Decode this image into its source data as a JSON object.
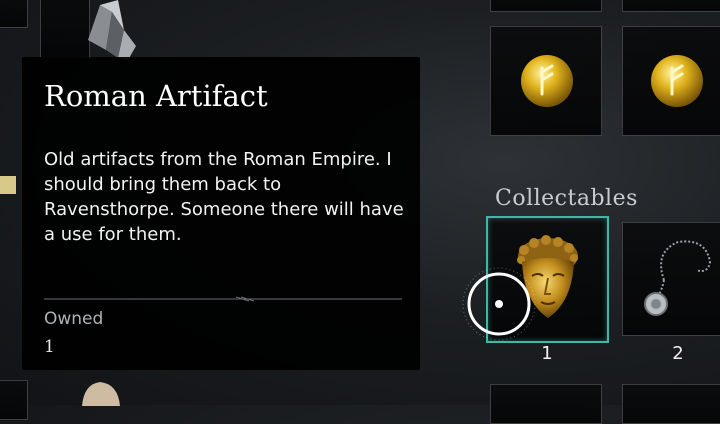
{
  "colors": {
    "accent": "#3fb6a6",
    "panel": "#000000",
    "rune_gold": "#e0b21c"
  },
  "tooltip": {
    "title": "Roman Artifact",
    "description": "Old artifacts from the Roman Empire. I should bring them back to Ravensthorpe. Someone there will have a use for them.",
    "owned_label": "Owned",
    "owned_value": "1"
  },
  "inventory": {
    "section_title": "Collectables",
    "items": [
      {
        "icon": "rune-icon",
        "count": ""
      },
      {
        "icon": "rune-icon",
        "count": ""
      },
      {
        "icon": "roman-artifact-mask-icon",
        "count": "1"
      },
      {
        "icon": "silver-pendant-icon",
        "count": "2"
      }
    ]
  },
  "cursor": {
    "icon": "selection-cursor-icon"
  }
}
